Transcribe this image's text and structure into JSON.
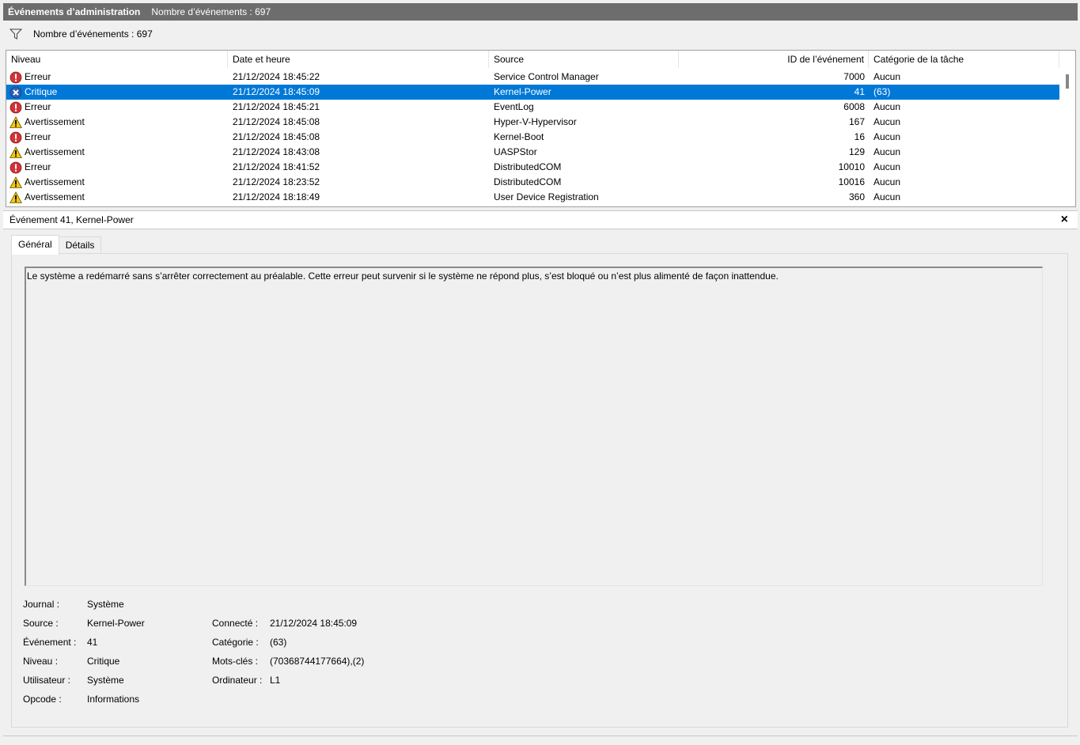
{
  "titlebar": {
    "title": "Événements d’administration",
    "count": "Nombre d’événements : 697"
  },
  "filter": {
    "label": "Nombre d’événements : 697",
    "icon": "filter-icon"
  },
  "columns": {
    "level": "Niveau",
    "date": "Date et heure",
    "source": "Source",
    "id": "ID de l’événement",
    "category": "Catégorie de la tâche"
  },
  "rows": [
    {
      "icon": "error-icon",
      "level": "Erreur",
      "date": "21/12/2024 18:45:22",
      "source": "Service Control Manager",
      "id": "7000",
      "category": "Aucun"
    },
    {
      "icon": "critical-icon",
      "level": "Critique",
      "date": "21/12/2024 18:45:09",
      "source": "Kernel-Power",
      "id": "41",
      "category": "(63)"
    },
    {
      "icon": "error-icon",
      "level": "Erreur",
      "date": "21/12/2024 18:45:21",
      "source": "EventLog",
      "id": "6008",
      "category": "Aucun"
    },
    {
      "icon": "warning-icon",
      "level": "Avertissement",
      "date": "21/12/2024 18:45:08",
      "source": "Hyper-V-Hypervisor",
      "id": "167",
      "category": "Aucun"
    },
    {
      "icon": "error-icon",
      "level": "Erreur",
      "date": "21/12/2024 18:45:08",
      "source": "Kernel-Boot",
      "id": "16",
      "category": "Aucun"
    },
    {
      "icon": "warning-icon",
      "level": "Avertissement",
      "date": "21/12/2024 18:43:08",
      "source": "UASPStor",
      "id": "129",
      "category": "Aucun"
    },
    {
      "icon": "error-icon",
      "level": "Erreur",
      "date": "21/12/2024 18:41:52",
      "source": "DistributedCOM",
      "id": "10010",
      "category": "Aucun"
    },
    {
      "icon": "warning-icon",
      "level": "Avertissement",
      "date": "21/12/2024 18:23:52",
      "source": "DistributedCOM",
      "id": "10016",
      "category": "Aucun"
    },
    {
      "icon": "warning-icon",
      "level": "Avertissement",
      "date": "21/12/2024 18:18:49",
      "source": "User Device Registration",
      "id": "360",
      "category": "Aucun"
    }
  ],
  "selected_row": 1,
  "detail": {
    "header": "Événement 41, Kernel-Power",
    "close": "×",
    "tabs": {
      "general": "Général",
      "details": "Détails"
    },
    "description": "Le système a redémarré sans s’arrêter correctement au préalable. Cette erreur peut survenir si le système ne répond plus, s’est bloqué ou n’est plus alimenté de façon inattendue.",
    "props": {
      "journal_label": "Journal :",
      "journal_value": "Système",
      "source_label": "Source :",
      "source_value": "Kernel-Power",
      "event_label": "Événement :",
      "event_value": "41",
      "level_label": "Niveau :",
      "level_value": "Critique",
      "user_label": "Utilisateur :",
      "user_value": "Système",
      "opcode_label": "Opcode :",
      "opcode_value": "Informations",
      "logged_label": "Connecté :",
      "logged_value": "21/12/2024 18:45:09",
      "category_label": "Catégorie :",
      "category_value": "(63)",
      "keywords_label": "Mots-clés :",
      "keywords_value": "(70368744177664),(2)",
      "computer_label": "Ordinateur :",
      "computer_value": "L1"
    }
  },
  "colors": {
    "selection": "#0078d7",
    "error": "#d13438",
    "critical": "#2f5fb3",
    "warning": "#f2c80f"
  }
}
